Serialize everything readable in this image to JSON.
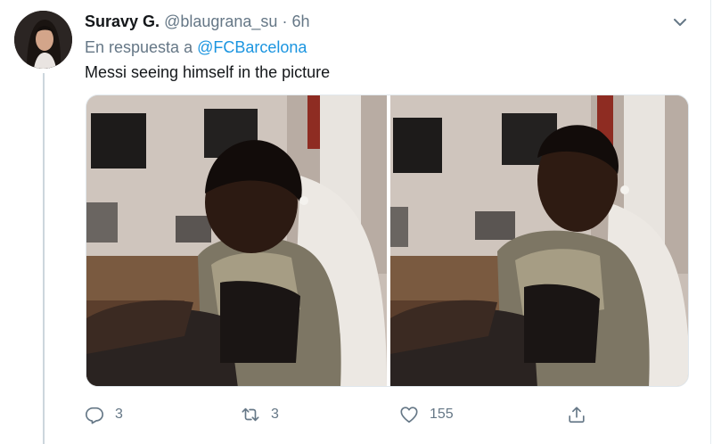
{
  "tweet": {
    "display_name": "Suravy G.",
    "handle": "@blaugrana_su",
    "separator": "·",
    "time": "6h",
    "reply_prefix": "En respuesta a",
    "reply_mention": "@FCBarcelona",
    "text": "Messi seeing himself in the picture",
    "photo_count": 2
  },
  "actions": {
    "reply_count": "3",
    "retweet_count": "3",
    "like_count": "155",
    "share_count": ""
  },
  "colors": {
    "text": "#14171a",
    "secondary": "#657786",
    "link": "#1b95e0",
    "border": "#e6ecf0"
  },
  "icons": [
    "caret-down-icon",
    "reply-icon",
    "retweet-icon",
    "like-icon",
    "share-icon"
  ]
}
